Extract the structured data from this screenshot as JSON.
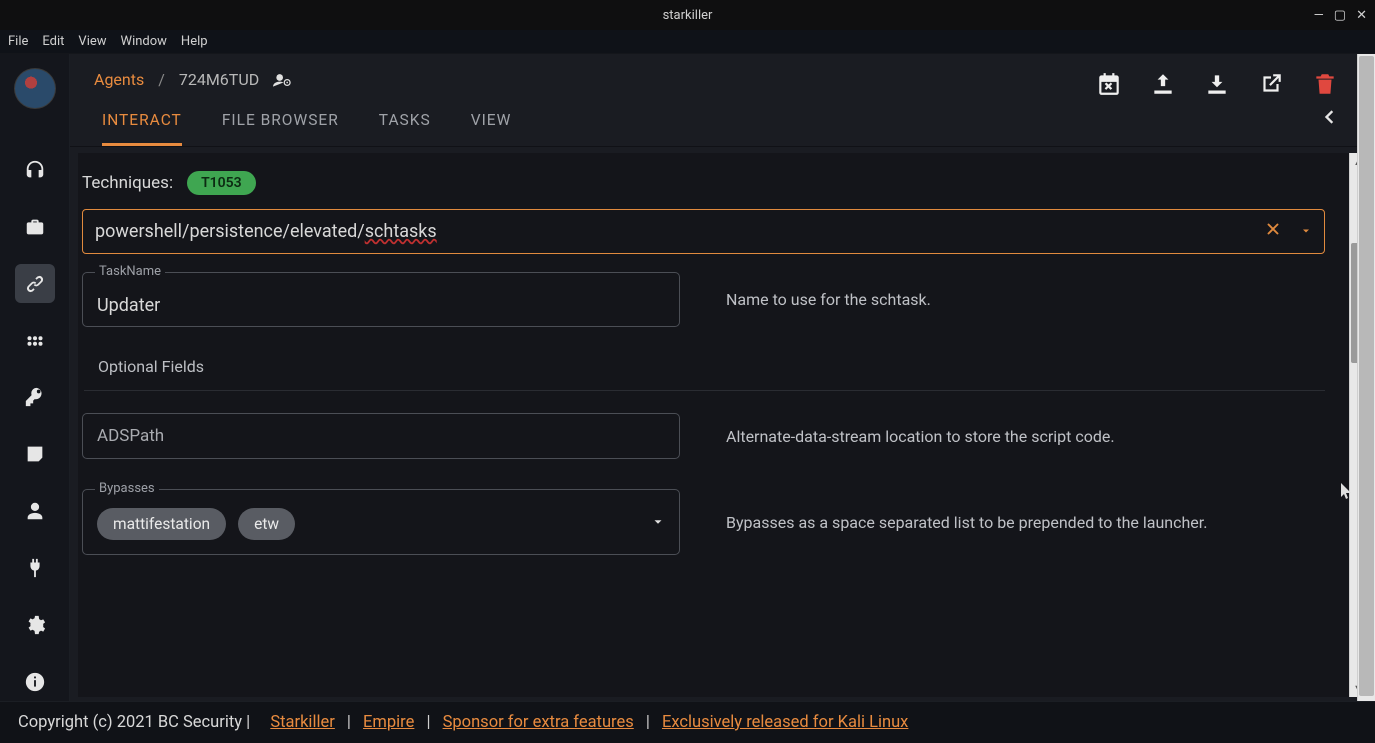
{
  "window": {
    "title": "starkiller"
  },
  "menubar": [
    "File",
    "Edit",
    "View",
    "Window",
    "Help"
  ],
  "breadcrumb": {
    "root": "Agents",
    "sep": "/",
    "current": "724M6TUD"
  },
  "tabs": {
    "interact": "INTERACT",
    "file_browser": "FILE BROWSER",
    "tasks": "TASKS",
    "view": "VIEW"
  },
  "techniques": {
    "label": "Techniques:",
    "badge": "T1053"
  },
  "module_select": {
    "prefix": "powershell/persistence/elevated/",
    "redpart": "schtasks"
  },
  "fields": {
    "taskname": {
      "label": "TaskName",
      "value": "Updater",
      "desc": "Name to use for the schtask."
    },
    "optional_label": "Optional Fields",
    "adspath": {
      "placeholder": "ADSPath",
      "desc": "Alternate-data-stream location to store the script code."
    },
    "bypasses": {
      "label": "Bypasses",
      "chips": [
        "mattifestation",
        "etw"
      ],
      "desc": "Bypasses as a space separated list to be prepended to the launcher."
    }
  },
  "footer": {
    "copyright": "Copyright (c) 2021 BC Security |",
    "links": [
      "Starkiller",
      "Empire",
      "Sponsor for extra features",
      "Exclusively released for Kali Linux"
    ]
  }
}
